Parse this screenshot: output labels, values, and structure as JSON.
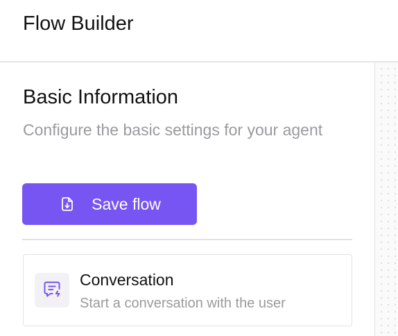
{
  "header": {
    "title": "Flow Builder"
  },
  "panel": {
    "title": "Basic Information",
    "description": "Configure the basic settings for your agent",
    "save_button": {
      "label": "Save flow",
      "icon": "file-download-icon"
    },
    "nodes": [
      {
        "title": "Conversation",
        "description": "Start a conversation with the user",
        "icon": "message-bolt-icon"
      }
    ]
  },
  "colors": {
    "accent": "#7655f2",
    "muted_text": "#9a9a9e",
    "border": "#e2e2e6",
    "icon_tile": "#f2f1f6"
  }
}
